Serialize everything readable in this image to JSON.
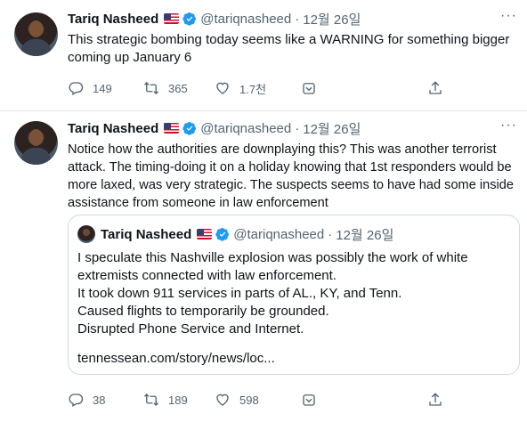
{
  "tweets": [
    {
      "name": "Tariq Nasheed",
      "handle": "@tariqnasheed",
      "separator": "·",
      "date": "12월 26일",
      "more": "···",
      "text": "This strategic bombing today seems like a WARNING for something bigger coming up January 6",
      "stats": {
        "replies": "149",
        "retweets": "365",
        "likes": "1.7천"
      }
    },
    {
      "name": "Tariq Nasheed",
      "handle": "@tariqnasheed",
      "separator": "·",
      "date": "12월 26일",
      "more": "···",
      "text": "Notice how the authorities are downplaying this? This was another terrorist attack. The timing-doing it on a holiday knowing that 1st responders would be more laxed, was very strategic. The suspects seems to have had some inside assistance from someone in law enforcement",
      "quote": {
        "name": "Tariq Nasheed",
        "handle": "@tariqnasheed",
        "separator": "·",
        "date": "12월 26일",
        "lines": [
          "I speculate this Nashville explosion was possibly the work of white",
          "extremists connected with law enforcement.",
          "It took down 911 services in parts of AL., KY, and Tenn.",
          "Caused flights to temporarily be grounded.",
          "Disrupted Phone Service and Internet."
        ],
        "link": "tennessean.com/story/news/loc..."
      },
      "stats": {
        "replies": "38",
        "retweets": "189",
        "likes": "598"
      }
    }
  ],
  "colors": {
    "text": "#0f1419",
    "secondary": "#536471",
    "verified": "#1d9bf0",
    "border": "#e1e8ed"
  },
  "icons": [
    "reply-icon",
    "retweet-icon",
    "like-icon",
    "extension-icon",
    "share-icon",
    "verified-badge-icon",
    "us-flag-icon",
    "more-icon"
  ]
}
